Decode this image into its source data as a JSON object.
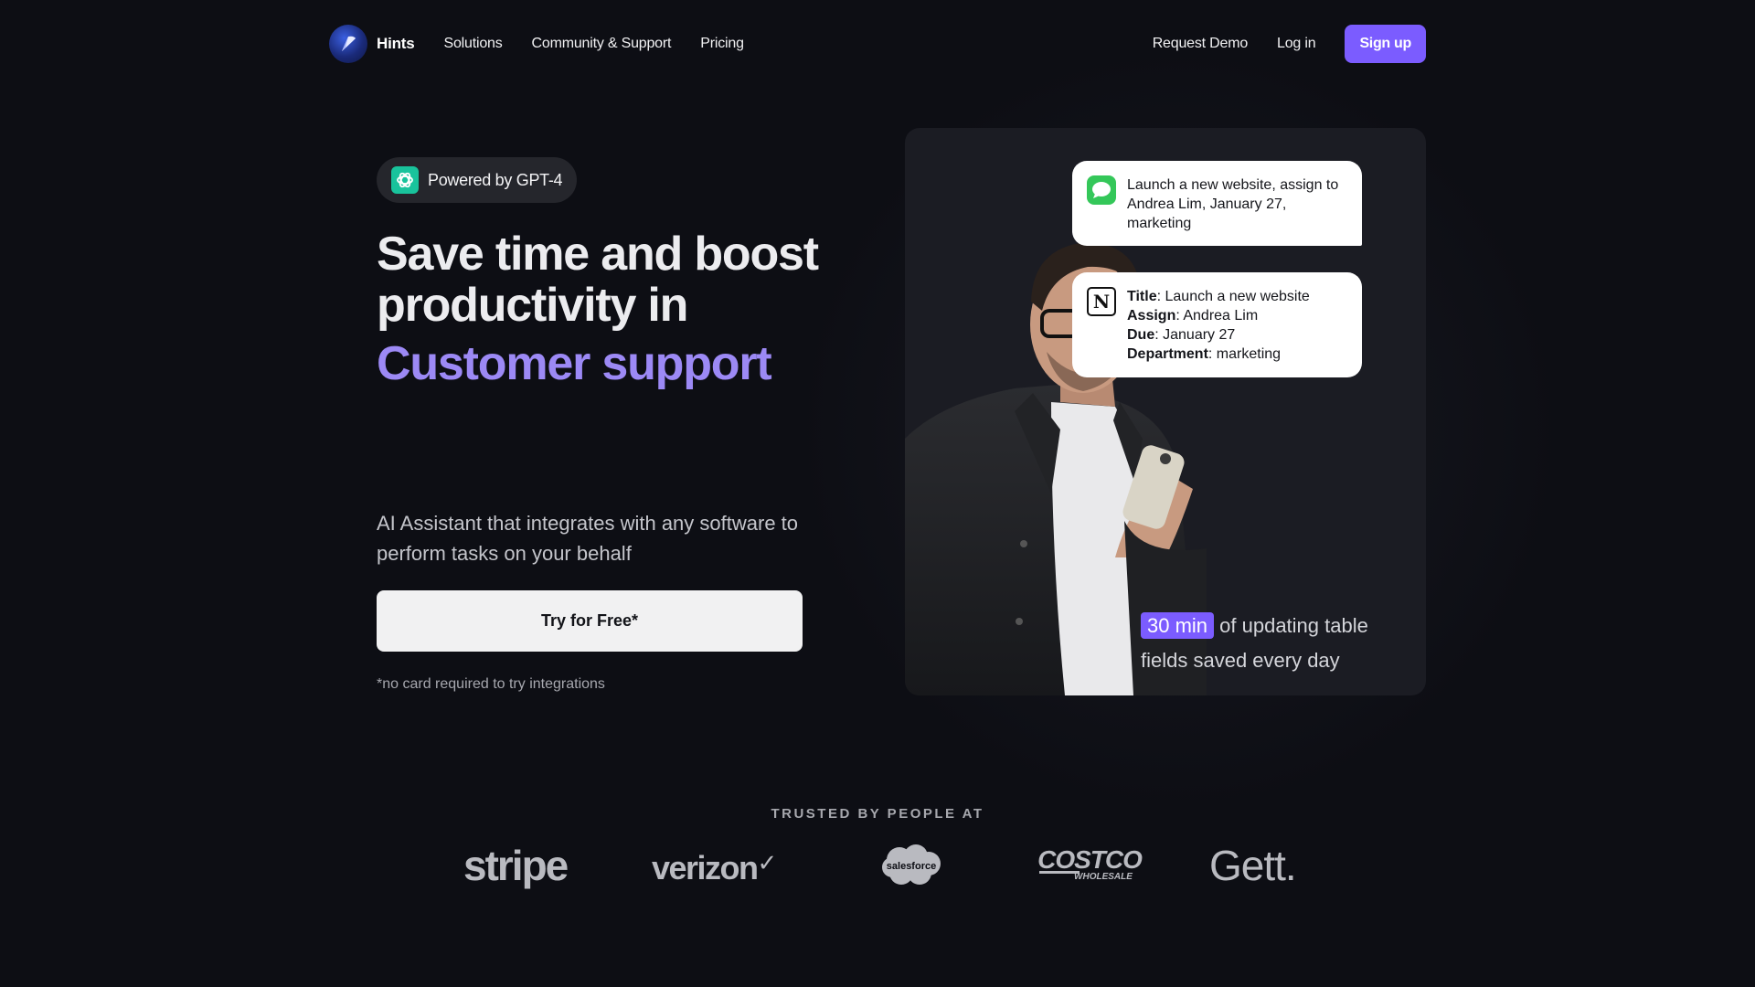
{
  "nav": {
    "brand": "Hints",
    "links": [
      "Solutions",
      "Community & Support",
      "Pricing"
    ],
    "request_demo": "Request Demo",
    "login": "Log in",
    "signup": "Sign up"
  },
  "hero": {
    "badge": "Powered by GPT-4",
    "headline": "Save time and boost productivity in",
    "headline_accent": "Customer support",
    "subtitle": "AI Assistant that integrates with any software to perform tasks on your behalf",
    "cta": "Try for Free*",
    "note": "*no card required to try integrations"
  },
  "card": {
    "message": "Launch a new website, assign to Andrea Lim, January 27, marketing",
    "fields": [
      {
        "label": "Title",
        "value": "Launch a new website"
      },
      {
        "label": "Assign",
        "value": "Andrea Lim"
      },
      {
        "label": "Due",
        "value": "January 27"
      },
      {
        "label": "Department",
        "value": "marketing"
      }
    ],
    "stat_value": "30 min",
    "stat_text": " of updating table fields saved every day"
  },
  "trusted": {
    "heading": "TRUSTED BY PEOPLE AT",
    "logos": [
      "stripe",
      "verizon",
      "salesforce",
      "COSTCO",
      "WHOLESALE",
      "Gett."
    ]
  },
  "colors": {
    "accent": "#7b5cff",
    "accent_text": "#9c89f5",
    "background": "#0d0e14"
  }
}
